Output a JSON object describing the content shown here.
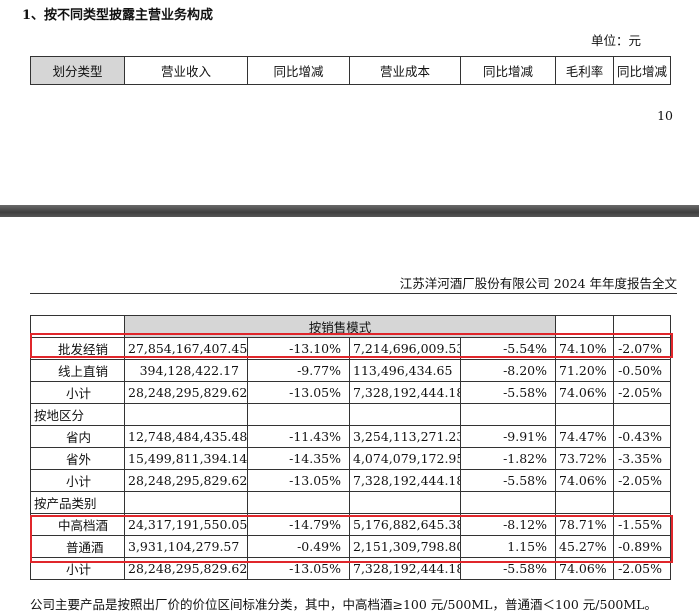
{
  "section_heading": "1、按不同类型披露主营业务构成",
  "unit_label": "单位：元",
  "header_columns": [
    "划分类型",
    "营业收入",
    "同比增减",
    "营业成本",
    "同比增减",
    "毛利率",
    "同比增减"
  ],
  "page_number": "10",
  "report_header": "江苏洋河酒厂股份有限公司 2024 年年度报告全文",
  "table": {
    "sales_mode": {
      "label": "按销售模式",
      "rows": [
        {
          "name": "批发经销",
          "revenue": "27,854,167,407.45",
          "revenue_yoy": "-13.10%",
          "cost": "7,214,696,009.53",
          "cost_yoy": "-5.54%",
          "margin": "74.10%",
          "margin_yoy": "-2.07%"
        },
        {
          "name": "线上直销",
          "revenue": "394,128,422.17",
          "revenue_yoy": "-9.77%",
          "cost": "113,496,434.65",
          "cost_yoy": "-8.20%",
          "margin": "71.20%",
          "margin_yoy": "-0.50%"
        },
        {
          "name": "小计",
          "revenue": "28,248,295,829.62",
          "revenue_yoy": "-13.05%",
          "cost": "7,328,192,444.18",
          "cost_yoy": "-5.58%",
          "margin": "74.06%",
          "margin_yoy": "-2.05%"
        }
      ]
    },
    "region": {
      "label": "按地区分",
      "rows": [
        {
          "name": "省内",
          "revenue": "12,748,484,435.48",
          "revenue_yoy": "-11.43%",
          "cost": "3,254,113,271.23",
          "cost_yoy": "-9.91%",
          "margin": "74.47%",
          "margin_yoy": "-0.43%"
        },
        {
          "name": "省外",
          "revenue": "15,499,811,394.14",
          "revenue_yoy": "-14.35%",
          "cost": "4,074,079,172.95",
          "cost_yoy": "-1.82%",
          "margin": "73.72%",
          "margin_yoy": "-3.35%"
        },
        {
          "name": "小计",
          "revenue": "28,248,295,829.62",
          "revenue_yoy": "-13.05%",
          "cost": "7,328,192,444.18",
          "cost_yoy": "-5.58%",
          "margin": "74.06%",
          "margin_yoy": "-2.05%"
        }
      ]
    },
    "product": {
      "label": "按产品类别",
      "rows": [
        {
          "name": "中高档酒",
          "revenue": "24,317,191,550.05",
          "revenue_yoy": "-14.79%",
          "cost": "5,176,882,645.38",
          "cost_yoy": "-8.12%",
          "margin": "78.71%",
          "margin_yoy": "-1.55%"
        },
        {
          "name": "普通酒",
          "revenue": "3,931,104,279.57",
          "revenue_yoy": "-0.49%",
          "cost": "2,151,309,798.80",
          "cost_yoy": "1.15%",
          "margin": "45.27%",
          "margin_yoy": "-0.89%"
        },
        {
          "name": "小计",
          "revenue": "28,248,295,829.62",
          "revenue_yoy": "-13.05%",
          "cost": "7,328,192,444.18",
          "cost_yoy": "-5.58%",
          "margin": "74.06%",
          "margin_yoy": "-2.05%"
        }
      ]
    }
  },
  "footnote": "公司主要产品是按照出厂价的价位区间标准分类，其中，中高档酒≥100 元/500ML，普通酒＜100 元/500ML。",
  "highlight_color": "#e0262b",
  "shade_color": "#d6d6d6"
}
